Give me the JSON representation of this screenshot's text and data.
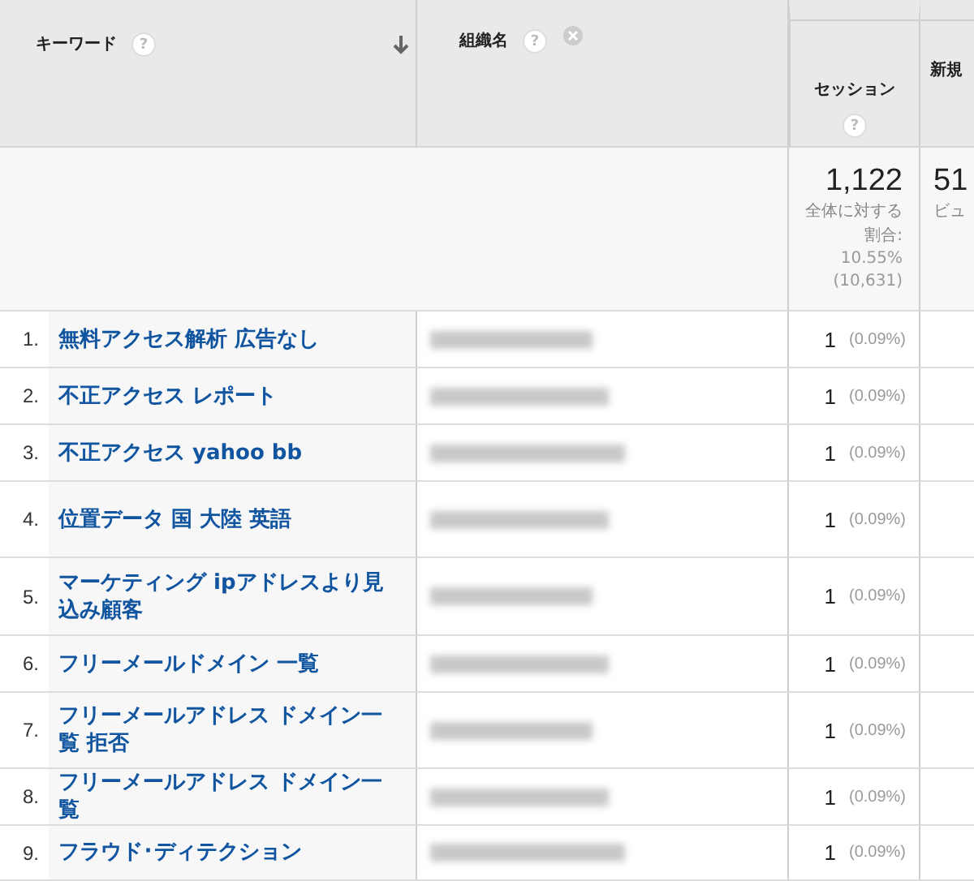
{
  "columns": [
    {
      "label": "キーワード",
      "help": "?",
      "sorted": true
    },
    {
      "label": "組織名",
      "help": "?",
      "removable": true
    },
    {
      "label": "セッション",
      "help": "?"
    },
    {
      "label": "新規"
    }
  ],
  "summary": {
    "sessions": {
      "value": "1,122",
      "note": "全体に対する割合:",
      "percent": "10.55%",
      "total": "(10,631)"
    },
    "column_4": {
      "value": "51",
      "note": "ビュ"
    }
  },
  "rows": [
    {
      "index": "1.",
      "keyword": "無料アクセス解析 広告なし",
      "sessions": "1",
      "share": "(0.09%)"
    },
    {
      "index": "2.",
      "keyword": "不正アクセス レポート",
      "sessions": "1",
      "share": "(0.09%)"
    },
    {
      "index": "3.",
      "keyword": "不正アクセス yahoo bb",
      "sessions": "1",
      "share": "(0.09%)"
    },
    {
      "index": "4.",
      "keyword": "位置データ 国 大陸 英語",
      "sessions": "1",
      "share": "(0.09%)"
    },
    {
      "index": "5.",
      "keyword": "マーケティング ipアドレスより見込み顧客",
      "sessions": "1",
      "share": "(0.09%)"
    },
    {
      "index": "6.",
      "keyword": "フリーメールドメイン 一覧",
      "sessions": "1",
      "share": "(0.09%)"
    },
    {
      "index": "7.",
      "keyword": "フリーメールアドレス ドメイン一覧 拒否",
      "sessions": "1",
      "share": "(0.09%)"
    },
    {
      "index": "8.",
      "keyword": "フリーメールアドレス ドメイン一覧",
      "sessions": "1",
      "share": "(0.09%)"
    },
    {
      "index": "9.",
      "keyword": "フラウド･ディテクション",
      "sessions": "1",
      "share": "(0.09%)"
    }
  ]
}
